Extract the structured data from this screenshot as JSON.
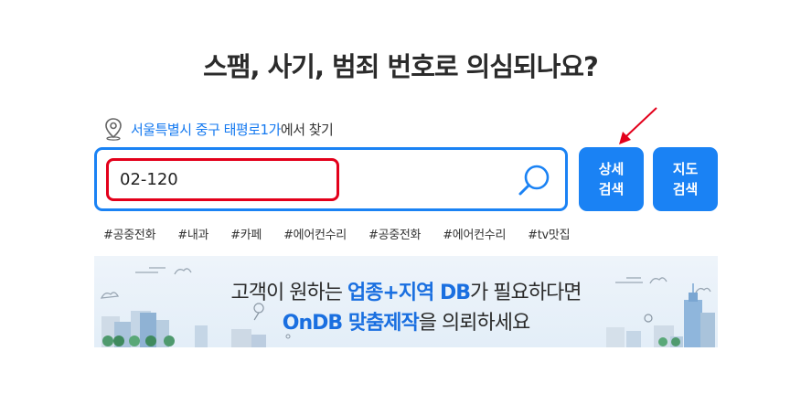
{
  "headline": "스팸, 사기, 범죄 번호로 의심되나요?",
  "location": {
    "place": "서울특별시 중구 태평로1가",
    "suffix": "에서 찾기"
  },
  "search": {
    "value": "02-120"
  },
  "buttons": {
    "detail_line1": "상세",
    "detail_line2": "검색",
    "map_line1": "지도",
    "map_line2": "검색"
  },
  "tags": [
    "#공중전화",
    "#내과",
    "#카페",
    "#에어컨수리",
    "#공중전화",
    "#에어컨수리",
    "#tv맛집"
  ],
  "banner": {
    "l1_prefix": "고객이 원하는 ",
    "l1_highlight": "업종+지역 DB",
    "l1_suffix": "가 필요하다면",
    "l2_highlight": "OnDB 맞춤제작",
    "l2_suffix": "을 의뢰하세요"
  },
  "colors": {
    "accent": "#1a82f4",
    "input_border": "#e3001b",
    "arrow": "#e3001b",
    "highlight": "#1a6fe0"
  },
  "icons": {
    "location": "map-pin-icon",
    "search": "magnifier-icon",
    "arrow": "red-arrow-icon"
  }
}
